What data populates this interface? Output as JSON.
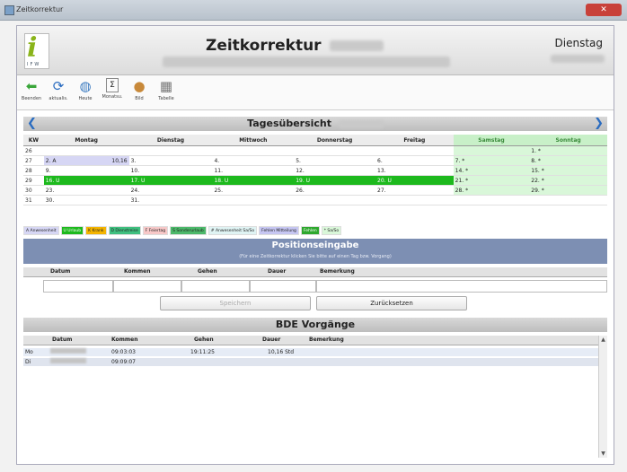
{
  "window": {
    "title": "Zeitkorrektur",
    "day_name": "Dienstag"
  },
  "header": {
    "title": "Zeitkorrektur",
    "logo_letter": "i",
    "logo_sub": "IFW"
  },
  "toolbar": [
    {
      "label": "Beenden",
      "icon": "back-arrow-icon"
    },
    {
      "label": "aktualis.",
      "icon": "refresh-icon"
    },
    {
      "label": "Heute",
      "icon": "globe-icon"
    },
    {
      "label": "Monatsu.",
      "icon": "sigma-icon"
    },
    {
      "label": "Bild",
      "icon": "person-icon"
    },
    {
      "label": "Tabelle",
      "icon": "table-icon"
    }
  ],
  "overview": {
    "title": "Tagesübersicht",
    "columns": [
      "KW",
      "Montag",
      "Dienstag",
      "Mittwoch",
      "Donnerstag",
      "Freitag",
      "Samstag",
      "Sonntag"
    ],
    "rows": [
      {
        "kw": "26",
        "cells": [
          "",
          "",
          "",
          "",
          "",
          "",
          "1. *"
        ]
      },
      {
        "kw": "27",
        "cells": [
          "2. A",
          "3.",
          "4.",
          "5.",
          "6.",
          "7. *",
          "8. *"
        ],
        "mon_extra": "10,16"
      },
      {
        "kw": "28",
        "cells": [
          "9.",
          "10.",
          "11.",
          "12.",
          "13.",
          "14. *",
          "15. *"
        ]
      },
      {
        "kw": "29",
        "cells": [
          "16. U",
          "17. U",
          "18. U",
          "19. U",
          "20. U",
          "21. *",
          "22. *"
        ],
        "green": true
      },
      {
        "kw": "30",
        "cells": [
          "23.",
          "24.",
          "25.",
          "26.",
          "27.",
          "28. *",
          "29. *"
        ]
      },
      {
        "kw": "31",
        "cells": [
          "30.",
          "31.",
          "",
          "",
          "",
          "",
          ""
        ]
      }
    ]
  },
  "legend": [
    {
      "label": "A Anwesenheit",
      "color": "#d6d6f4"
    },
    {
      "label": "U Urlaub",
      "color": "#1db91d"
    },
    {
      "label": "K Krank",
      "color": "#f4b400"
    },
    {
      "label": "D Dienstreise",
      "color": "#3fbf7f"
    },
    {
      "label": "F Feiertag",
      "color": "#f7c8c8"
    },
    {
      "label": "S Sonderurlaub",
      "color": "#4cb86a"
    },
    {
      "label": "# Anwesenheit Sa/So",
      "color": "#dff3f3"
    },
    {
      "label": "Fehlen Mitteilung",
      "color": "#c6c6f2"
    },
    {
      "label": "Fehlen",
      "color": "#2ea82e"
    },
    {
      "label": "* Sa/So",
      "color": "#d9f7d9"
    }
  ],
  "position_entry": {
    "title": "Positionseingabe",
    "hint": "(Für eine Zeitkorrektur klicken Sie bitte auf einen Tag bzw. Vorgang)",
    "columns": [
      "Datum",
      "Kommen",
      "Gehen",
      "Dauer",
      "Bemerkung"
    ],
    "save_label": "Speichern",
    "reset_label": "Zurücksetzen"
  },
  "bde": {
    "title": "BDE Vorgänge",
    "columns": [
      "Datum",
      "Kommen",
      "Gehen",
      "Dauer",
      "Bemerkung"
    ],
    "rows": [
      {
        "day": "Mo",
        "kommen": "09:03:03",
        "gehen": "19:11:25",
        "dauer": "10,16 Std",
        "bemerkung": ""
      },
      {
        "day": "Di",
        "kommen": "09:09:07",
        "gehen": "",
        "dauer": "",
        "bemerkung": ""
      }
    ]
  }
}
